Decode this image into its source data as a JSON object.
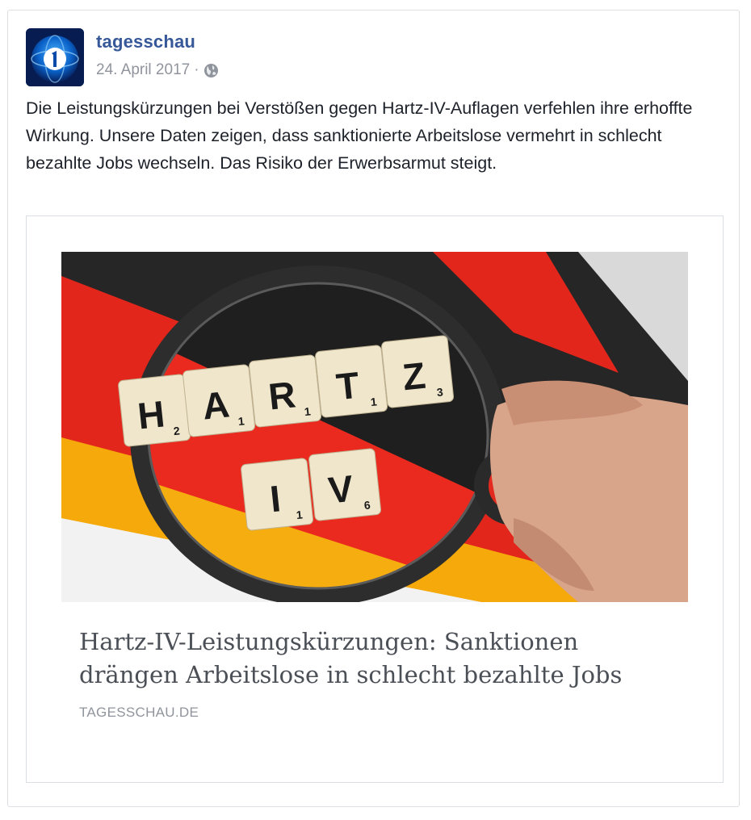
{
  "post": {
    "page_name": "tagesschau",
    "date": "24. April 2017",
    "separator": "·",
    "audience_icon": "globe-icon",
    "text": "Die Leistungskürzungen bei Verstößen gegen Hartz-IV-Auflagen verfehlen ihre erhoffte Wirkung. Unsere Daten zeigen, dass sanktionierte Arbeitslose vermehrt in schlecht bezahlte Jobs wechseln. Das Risiko der Erwerbsarmut steigt."
  },
  "link": {
    "title": "Hartz-IV-Leistungskürzungen: Sanktionen drängen Arbeitslose in schlecht bezahlte Jobs",
    "domain": "TAGESSCHAU.DE",
    "image": {
      "description_icon": "magnifier-photo",
      "tiles": [
        {
          "letter": "H",
          "score": "2"
        },
        {
          "letter": "A",
          "score": "1"
        },
        {
          "letter": "R",
          "score": "1"
        },
        {
          "letter": "T",
          "score": "1"
        },
        {
          "letter": "Z",
          "score": "3"
        },
        {
          "letter": "I",
          "score": "1"
        },
        {
          "letter": "V",
          "score": "6"
        }
      ]
    }
  },
  "colors": {
    "page_name": "#365899",
    "meta": "#90949c",
    "text": "#1d2129",
    "flag_black": "#1a1a1a",
    "flag_red": "#e3261c",
    "flag_gold": "#f5a90a"
  }
}
